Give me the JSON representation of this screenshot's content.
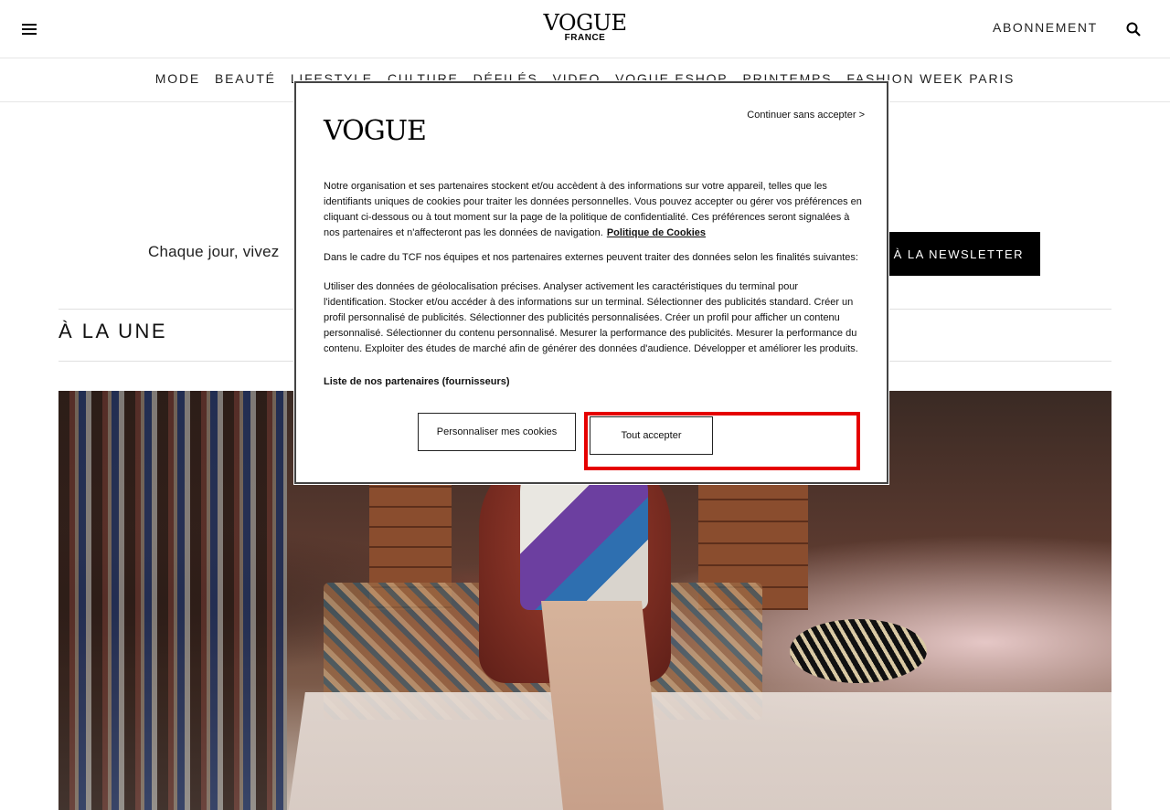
{
  "header": {
    "logo_word": "VOGUE",
    "logo_sub": "FRANCE",
    "subscribe_label": "ABONNEMENT"
  },
  "nav": {
    "items": [
      "MODE",
      "BEAUTÉ",
      "LIFESTYLE",
      "CULTURE",
      "DÉFILÉS",
      "VIDEO",
      "VOGUE ESHOP",
      "PRINTEMPS",
      "FASHION WEEK PARIS"
    ]
  },
  "newsletter": {
    "text": "Chaque jour, vivez",
    "button_label": "US À LA NEWSLETTER"
  },
  "section": {
    "title": "À LA UNE"
  },
  "modal": {
    "logo": "VOGUE",
    "continue_label": "Continuer sans accepter >",
    "paragraph1": "Notre organisation et ses partenaires stockent et/ou accèdent à des informations sur votre appareil, telles que les identifiants uniques de cookies pour traiter les données personnelles. Vous pouvez accepter ou gérer vos préférences en cliquant ci-dessous ou à tout moment sur la page de la politique de confidentialité. Ces préférences seront signalées à nos partenaires et n'affecteront pas les données de navigation.",
    "cookie_policy_link": "Politique de Cookies",
    "paragraph2": "Dans le cadre du TCF nos équipes et nos partenaires externes peuvent traiter des données selon les finalités suivantes:",
    "paragraph3": "Utiliser des données de géolocalisation précises. Analyser activement les caractéristiques du terminal pour l'identification. Stocker et/ou accéder à des informations sur un terminal. Sélectionner des publicités standard. Créer un profil personnalisé de publicités. Sélectionner des publicités personnalisées. Créer un profil pour afficher un contenu personnalisé. Sélectionner du contenu personnalisé. Mesurer la performance des publicités. Mesurer la performance du contenu. Exploiter des études de marché afin de générer des données d'audience. Développer et améliorer les produits.",
    "partners_link": "Liste de nos partenaires (fournisseurs)",
    "customize_label": "Personnaliser mes cookies",
    "accept_label": "Tout accepter"
  },
  "colors": {
    "highlight": "#e50000",
    "newsletter_button_bg": "#000000"
  }
}
